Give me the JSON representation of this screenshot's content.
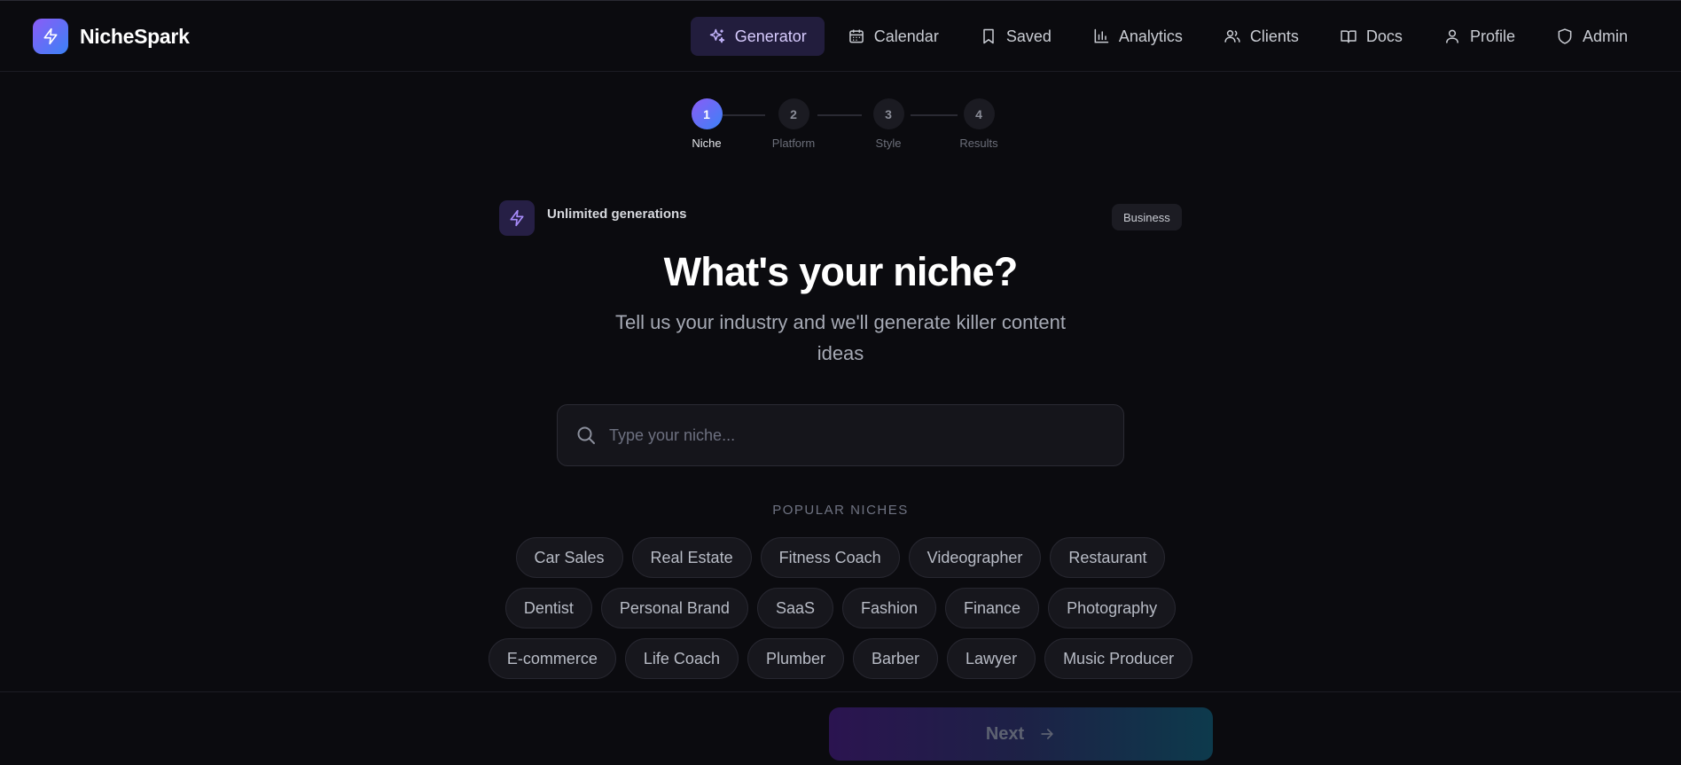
{
  "brand": {
    "name": "NicheSpark",
    "logo_icon": "lightning-icon"
  },
  "nav": {
    "items": [
      {
        "label": "Generator",
        "icon": "sparkles-icon",
        "active": true
      },
      {
        "label": "Calendar",
        "icon": "calendar-icon"
      },
      {
        "label": "Saved",
        "icon": "bookmark-icon"
      },
      {
        "label": "Analytics",
        "icon": "bar-chart-icon"
      },
      {
        "label": "Clients",
        "icon": "users-icon"
      },
      {
        "label": "Docs",
        "icon": "book-icon"
      },
      {
        "label": "Profile",
        "icon": "user-icon"
      },
      {
        "label": "Admin",
        "icon": "shield-icon"
      }
    ]
  },
  "stepper": {
    "current": 1,
    "steps": [
      {
        "number": "1",
        "label": "Niche"
      },
      {
        "number": "2",
        "label": "Platform"
      },
      {
        "number": "3",
        "label": "Style"
      },
      {
        "number": "4",
        "label": "Results"
      }
    ]
  },
  "usage": {
    "text": "Unlimited generations",
    "icon": "lightning-icon"
  },
  "plan": {
    "label": "Business"
  },
  "main": {
    "headline": "What's your niche?",
    "subline": "Tell us your industry and we'll generate killer content ideas"
  },
  "search": {
    "placeholder": "Type your niche...",
    "value": "",
    "icon": "search-icon"
  },
  "popular": {
    "label": "POPULAR NICHES",
    "rows": [
      [
        "Car Sales",
        "Real Estate",
        "Fitness Coach",
        "Videographer",
        "Restaurant"
      ],
      [
        "Dentist",
        "Personal Brand",
        "SaaS",
        "Fashion",
        "Finance",
        "Photography"
      ],
      [
        "E-commerce",
        "Life Coach",
        "Plumber",
        "Barber",
        "Lawyer",
        "Music Producer"
      ]
    ]
  },
  "footer": {
    "next_label": "Next",
    "next_icon": "arrow-right-icon"
  },
  "colors": {
    "background": "#0b0b0f",
    "accent_purple": "#8b5cf6",
    "accent_blue": "#3b82f6",
    "active_nav_bg": "#221d3d"
  }
}
